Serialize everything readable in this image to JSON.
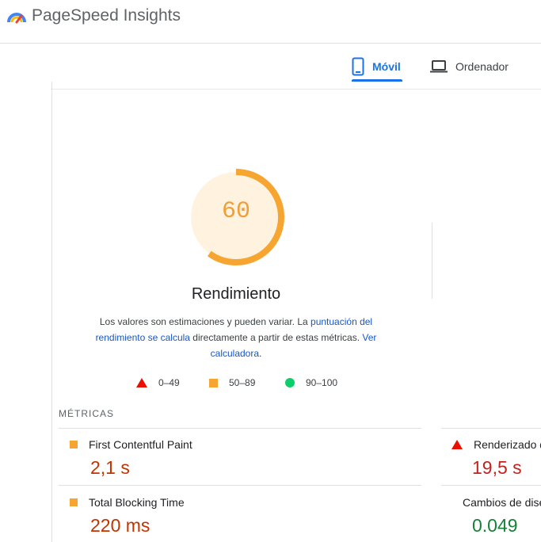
{
  "app": {
    "title": "PageSpeed Insights"
  },
  "tabs": [
    {
      "label": "Móvil",
      "active": true,
      "icon": "phone-icon"
    },
    {
      "label": "Ordenador",
      "active": false,
      "icon": "laptop-icon"
    }
  ],
  "gauge": {
    "score": "60",
    "title": "Rendimiento",
    "fraction": 0.6,
    "color": "#f7a531"
  },
  "description": {
    "part1": "Los valores son estimaciones y pueden variar. La ",
    "link1": "puntuación del rendimiento se calcula",
    "part2": " directamente a partir de estas métricas. ",
    "link2": "Ver calculadora",
    "part3": "."
  },
  "legend": [
    {
      "label": "0–49",
      "icon": "red-triangle-icon"
    },
    {
      "label": "50–89",
      "icon": "orange-square-icon"
    },
    {
      "label": "90–100",
      "icon": "green-circle-icon"
    }
  ],
  "metrics": {
    "heading": "MÉTRICAS",
    "items": [
      {
        "label": "First Contentful Paint",
        "value": "2,1 s",
        "status": "average"
      },
      {
        "label": "Renderizado del mayor elemento con contenido",
        "value": "19,5 s",
        "status": "fail"
      },
      {
        "label": "Total Blocking Time",
        "value": "220 ms",
        "status": "average"
      },
      {
        "label": "Cambios de diseño acumulados",
        "value": "0.049",
        "status": "pass"
      }
    ]
  },
  "colors": {
    "accent": "#1a73e8",
    "fail": "#eb0f00",
    "average": "#f7a531",
    "pass": "#0cce6b"
  }
}
